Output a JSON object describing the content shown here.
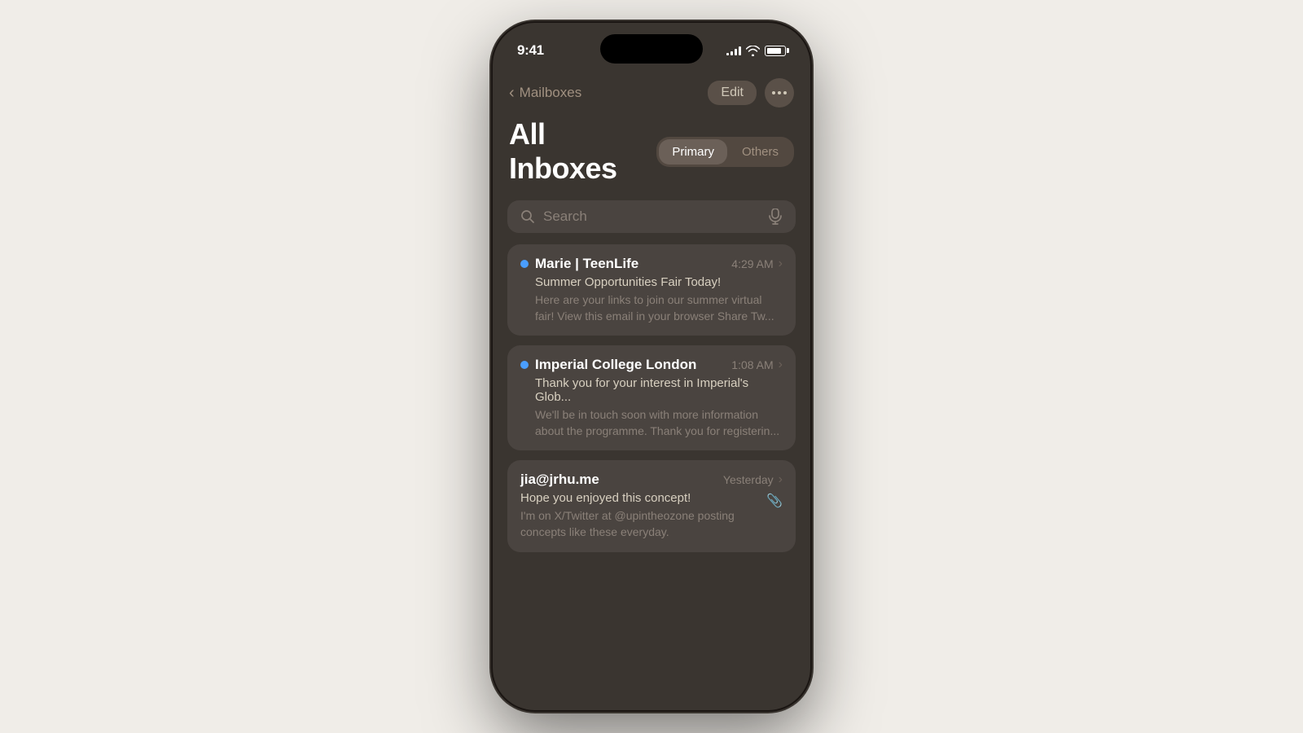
{
  "statusBar": {
    "time": "9:41",
    "signal": [
      4,
      6,
      8,
      10,
      12
    ],
    "batteryLevel": "85%"
  },
  "navigation": {
    "backLabel": "Mailboxes",
    "editButton": "Edit",
    "moreButtonAriaLabel": "More options"
  },
  "header": {
    "title": "All Inboxes",
    "segmentPrimary": "Primary",
    "segmentOthers": "Others"
  },
  "search": {
    "placeholder": "Search"
  },
  "emails": [
    {
      "sender": "Marie | TeenLife",
      "time": "4:29 AM",
      "subject": "Summer Opportunities Fair Today!",
      "preview": "Here are your links to join our summer virtual fair! View this email in your browser Share Tw...",
      "unread": true,
      "attachment": false
    },
    {
      "sender": "Imperial College London",
      "time": "1:08 AM",
      "subject": "Thank you for your interest in Imperial's Glob...",
      "preview": "We'll be in touch soon with more information about the programme. Thank you for registerin...",
      "unread": true,
      "attachment": false
    },
    {
      "sender": "jia@jrhu.me",
      "time": "Yesterday",
      "subject": "Hope you enjoyed this concept!",
      "preview": "I'm on X/Twitter at @upintheozone posting concepts like these everyday.",
      "unread": false,
      "attachment": true
    }
  ]
}
